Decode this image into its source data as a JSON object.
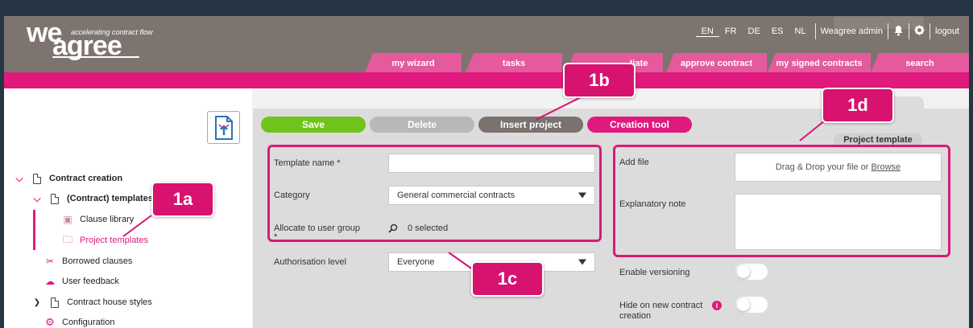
{
  "header": {
    "logo_word_1": "we",
    "logo_word_2": "agree",
    "tagline": "accelerating contract flow",
    "languages": [
      "EN",
      "FR",
      "DE",
      "ES",
      "NL"
    ],
    "active_language": "EN",
    "user_name": "Weagree admin",
    "logout_label": "logout"
  },
  "nav_tabs": [
    {
      "label": "my wizard"
    },
    {
      "label": "tasks"
    },
    {
      "label": "tiate"
    },
    {
      "label": "approve contract"
    },
    {
      "label": "my signed contracts"
    },
    {
      "label": "search"
    }
  ],
  "toolbar": {
    "save_label": "Save",
    "delete_label": "Delete",
    "insert_project_label": "Insert project",
    "creation_tool_label": "Creation tool"
  },
  "sidebar": {
    "items": [
      {
        "label": "Contract creation"
      },
      {
        "label": "(Contract) templates"
      },
      {
        "label": "Clause library"
      },
      {
        "label": "Project templates"
      },
      {
        "label": "Borrowed clauses"
      },
      {
        "label": "User feedback"
      },
      {
        "label": "Contract house styles"
      },
      {
        "label": "Configuration"
      }
    ]
  },
  "form_left": {
    "template_name_label": "Template name *",
    "template_name_value": "",
    "category_label": "Category",
    "category_value": "General commercial contracts",
    "allocate_label": "Allocate to user group",
    "allocate_required": "*",
    "allocate_value": "0 selected",
    "authorisation_label": "Authorisation level",
    "authorisation_value": "Everyone"
  },
  "form_right": {
    "section_tab": "Project template",
    "add_file_label": "Add file",
    "drop_text": "Drag & Drop your file or ",
    "browse_link": "Browse",
    "explanatory_label": "Explanatory note",
    "explanatory_value": "",
    "versioning_label": "Enable versioning",
    "hide_label": "Hide on new contract creation"
  },
  "callouts": {
    "c1a": "1a",
    "c1b": "1b",
    "c1c": "1c",
    "c1d": "1d"
  },
  "colors": {
    "brand_pink": "#e0197d",
    "header_grey": "#7d7470",
    "save_green": "#6fc31c",
    "delete_grey": "#b8b8b8",
    "insert_dark": "#7a726e"
  }
}
